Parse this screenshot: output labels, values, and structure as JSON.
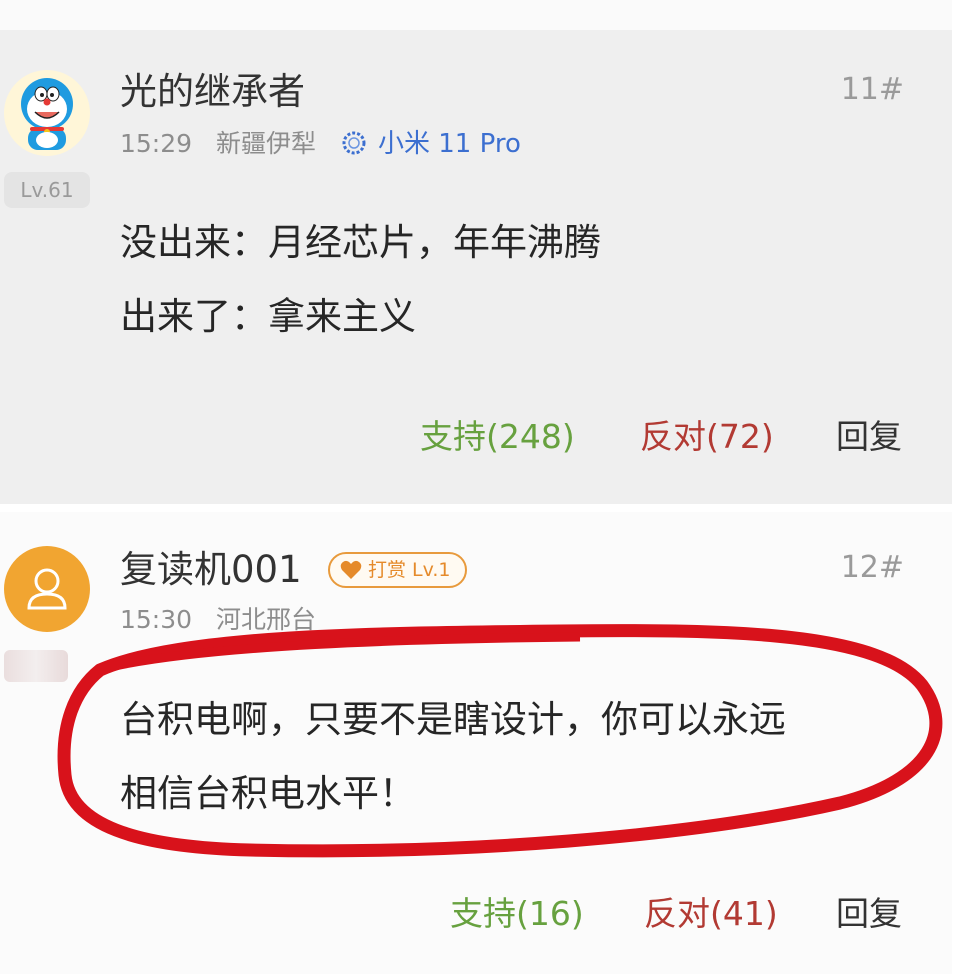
{
  "posts": [
    {
      "username": "光的继承者",
      "floor": "11#",
      "level": "Lv.61",
      "time": "15:29",
      "location": "新疆伊犁",
      "device": "小米 11 Pro",
      "content": [
        "没出来：月经芯片，年年沸腾",
        "出来了：拿来主义"
      ],
      "support": "支持(248)",
      "oppose": "反对(72)",
      "reply": "回复"
    },
    {
      "username": "复读机001",
      "floor": "12#",
      "tip_badge": "打赏 Lv.1",
      "time": "15:30",
      "location": "河北邢台",
      "content": [
        "台积电啊，只要不是瞎设计，你可以永远",
        "相信台积电水平！"
      ],
      "support": "支持(16)",
      "oppose": "反对(41)",
      "reply": "回复"
    }
  ],
  "colors": {
    "support": "#67a13f",
    "oppose": "#b23a33",
    "device": "#3c6fd0",
    "tip": "#e58a2a",
    "highlight": "#d8121b"
  },
  "icons": {
    "avatar1": "doraemon-avatar",
    "avatar2": "default-user-avatar",
    "device": "device-ring-icon",
    "tip": "heart-icon"
  }
}
